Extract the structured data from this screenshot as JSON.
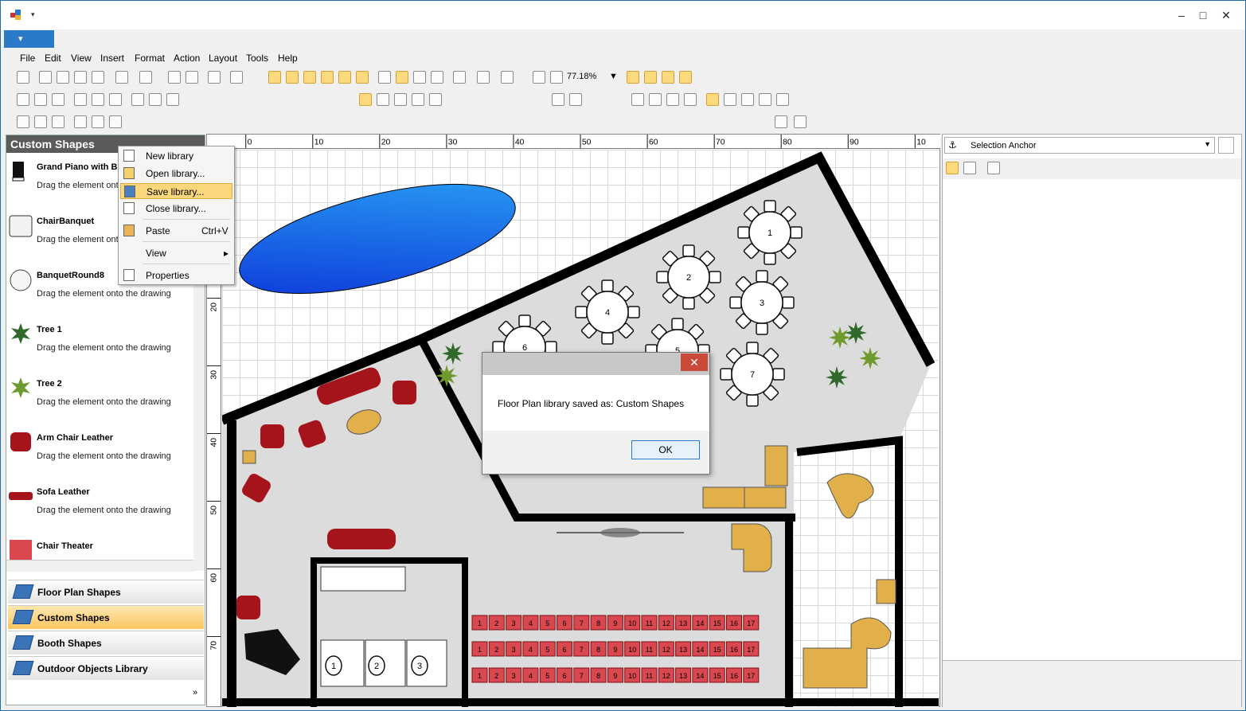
{
  "menu": [
    "File",
    "Edit",
    "View",
    "Insert",
    "Format",
    "Action",
    "Layout",
    "Tools",
    "Help"
  ],
  "toolbar": {
    "zoom": "77.18%"
  },
  "left_panel": {
    "title": "Custom Shapes",
    "items": [
      {
        "name": "Grand Piano with B",
        "desc": "Drag the element ont"
      },
      {
        "name": "ChairBanquet",
        "desc": "Drag the element ont"
      },
      {
        "name": "BanquetRound8",
        "desc": "Drag the element onto the drawing"
      },
      {
        "name": "Tree 1",
        "desc": "Drag the element onto the drawing"
      },
      {
        "name": "Tree 2",
        "desc": "Drag the element onto the drawing"
      },
      {
        "name": "Arm Chair Leather",
        "desc": "Drag the element onto the drawing"
      },
      {
        "name": "Sofa Leather",
        "desc": "Drag the element onto the drawing"
      },
      {
        "name": "Chair Theater",
        "desc": ""
      }
    ],
    "libraries": [
      "Floor Plan Shapes",
      "Custom Shapes",
      "Booth Shapes",
      "Outdoor Objects Library"
    ]
  },
  "context_menu": {
    "items": [
      "New library",
      "Open library...",
      "Save library...",
      "Close library...",
      "Paste",
      "View",
      "Properties"
    ],
    "paste_shortcut": "Ctrl+V",
    "highlighted": "Save library..."
  },
  "ruler": {
    "h": [
      "0",
      "10",
      "20",
      "30",
      "40",
      "50",
      "60",
      "70",
      "80",
      "90",
      "10"
    ],
    "v": [
      "20",
      "30",
      "40",
      "50",
      "60",
      "70"
    ]
  },
  "right_panel": {
    "selector": "Selection Anchor"
  },
  "dialog": {
    "message": "Floor Plan library saved as: Custom Shapes",
    "ok": "OK",
    "close": "✕"
  },
  "seat_numbers": [
    "1",
    "2",
    "3",
    "4",
    "5",
    "6",
    "7",
    "8",
    "9",
    "10",
    "11",
    "12",
    "13",
    "14",
    "15",
    "16",
    "17"
  ],
  "tables": [
    "1",
    "2",
    "3",
    "4",
    "5",
    "6",
    "7"
  ],
  "stalls": [
    "1",
    "2",
    "3"
  ]
}
